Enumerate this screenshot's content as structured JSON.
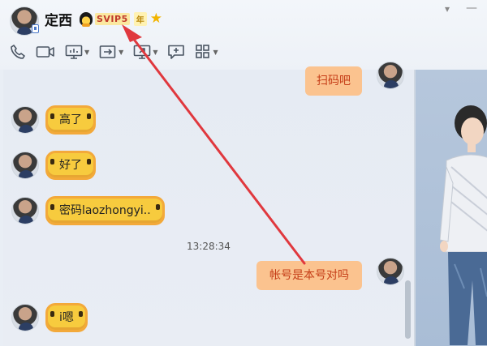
{
  "header": {
    "contact_name": "定西",
    "svip_label": "SVIP5",
    "year_label": "年"
  },
  "toolbar": {
    "items": [
      {
        "icon": "phone-icon"
      },
      {
        "icon": "video-icon"
      },
      {
        "icon": "screen-share-icon"
      },
      {
        "icon": "file-transfer-icon"
      },
      {
        "icon": "remote-desktop-icon"
      },
      {
        "icon": "message-icon"
      },
      {
        "icon": "apps-grid-icon"
      }
    ]
  },
  "chat": {
    "messages": [
      {
        "side": "right",
        "text": "扫码吧"
      },
      {
        "side": "left",
        "text": "高了"
      },
      {
        "side": "left",
        "text": "好了"
      },
      {
        "side": "left",
        "text": "密码laozhongyi.."
      },
      {
        "timestamp": "13:28:34"
      },
      {
        "side": "right",
        "text": "帐号是本号对吗"
      },
      {
        "side": "left",
        "text": "i嗯"
      }
    ]
  },
  "colors": {
    "accent_arrow": "#e0383e",
    "bubble_yellow": "#f7cb3e",
    "bubble_orange": "#fbc38f",
    "panel_blue": "#b0c3da"
  }
}
